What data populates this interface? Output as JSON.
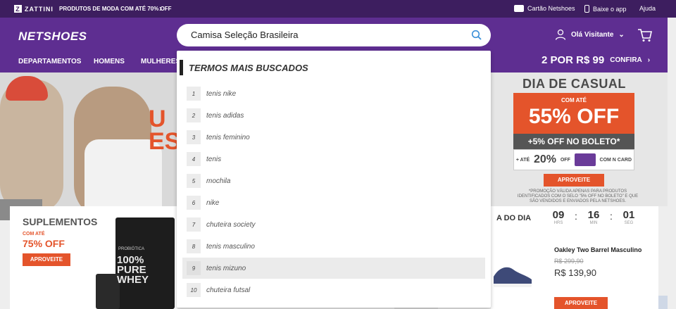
{
  "topbar": {
    "brand": "ZATTINI",
    "promo": "PRODUTOS DE MODA COM ATÉ 70% OFF",
    "links": [
      "Cartão Netshoes",
      "Baixe o app",
      "Ajuda"
    ]
  },
  "header": {
    "logo": "NETSHOES",
    "search": {
      "value": "Camisa Seleção Brasileira"
    },
    "user_label": "Olá Visitante",
    "deal_big": "2 POR R$ 99",
    "deal_small": "CONFIRA"
  },
  "nav": [
    "DEPARTAMENTOS",
    "HOMENS",
    "MULHERES"
  ],
  "dropdown": {
    "title": "TERMOS MAIS BUSCADOS",
    "items": [
      {
        "n": "1",
        "term": "tenis nike"
      },
      {
        "n": "2",
        "term": "tenis adidas"
      },
      {
        "n": "3",
        "term": "tenis feminino"
      },
      {
        "n": "4",
        "term": "tenis"
      },
      {
        "n": "5",
        "term": "mochila"
      },
      {
        "n": "6",
        "term": "nike"
      },
      {
        "n": "7",
        "term": "chuteira society"
      },
      {
        "n": "8",
        "term": "tenis masculino"
      },
      {
        "n": "9",
        "term": "tenis mizuno"
      },
      {
        "n": "10",
        "term": "chuteira futsal"
      }
    ],
    "highlighted_index": 8
  },
  "banner_left": {
    "text_line1": "U",
    "text_line2": "ES"
  },
  "banner_right": {
    "title": "DIA DE CASUAL",
    "com_ate": "COM ATÉ",
    "off": "55% OFF",
    "boleto": "+5% OFF NO BOLETO*",
    "card_pre": "+ ATÉ",
    "card_pct": "20%",
    "card_off": "OFF",
    "card_with": "COM N CARD",
    "button": "APROVEITE",
    "disclaimer": "*PROMOÇÃO VÁLIDA APENAS PARA PRODUTOS IDENTIFICADOS COM O SELO \"5% OFF NO BOLETO\" E QUE SÃO VENDIDOS E ENVIADOS PELA NETSHOES."
  },
  "suplementos": {
    "title": "SUPLEMENTOS",
    "com_ate": "COM ATÉ",
    "pct": "75% OFF",
    "button": "APROVEITE",
    "product_brand": "PROBIÓTICA",
    "product_label": "100% PURE WHEY"
  },
  "deal_of_day": {
    "title": "A DO DIA",
    "timer": [
      {
        "num": "09",
        "label": "HRS"
      },
      {
        "num": "16",
        "label": "MIN"
      },
      {
        "num": "01",
        "label": "SEG"
      }
    ],
    "product_name": "Oakley Two Barrel Masculino",
    "old_price": "R$ 299,90",
    "price": "R$ 139,90",
    "button": "APROVEITE"
  },
  "colors": {
    "purple_dark": "#3d1e5f",
    "purple": "#5e2e91",
    "orange": "#e4542b"
  }
}
